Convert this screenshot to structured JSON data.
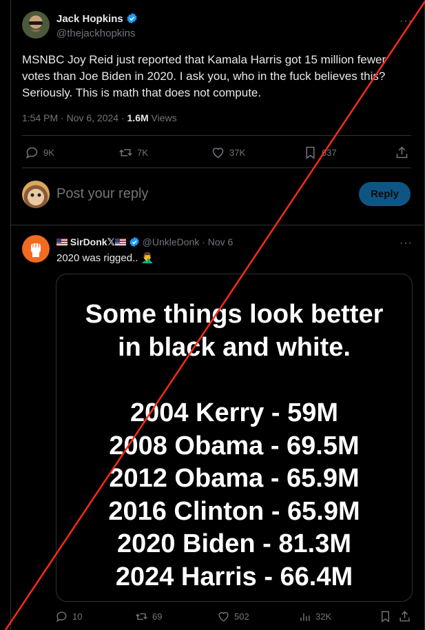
{
  "tweet": {
    "author_name": "Jack Hopkins",
    "author_handle": "@thejackhopkins",
    "text_lines": [
      "MSNBC Joy Reid just reported that Kamala Harris got 15 million fewer",
      "votes than Joe Biden in 2020. I ask you, who in the fuck believes this?",
      "Seriously. This is math that does not compute."
    ],
    "time": "1:54 PM · Nov 6, 2024 · ",
    "views_count": "1.6M",
    "views_label": " Views",
    "actions": {
      "replies": "9K",
      "reposts": "7K",
      "likes": "37K",
      "bookmarks": "637"
    }
  },
  "reply_box": {
    "placeholder": "Post your reply",
    "button": "Reply"
  },
  "reply": {
    "author_name": "SirDonk",
    "author_handle": "@UnkleDonk",
    "date": " · Nov 6",
    "text": "2020 was rigged.. 🤦‍♂️",
    "image_lines_top": [
      "Some things look better",
      "in black and white."
    ],
    "image_lines_bottom": [
      "2004 Kerry - 59M",
      "2008 Obama - 69.5M",
      "2012 Obama - 65.9M",
      "2016 Clinton - 65.9M",
      "2020 Biden - 81.3M",
      "2024 Harris - 66.4M"
    ],
    "actions": {
      "replies": "10",
      "reposts": "69",
      "likes": "502",
      "views": "32K"
    }
  },
  "colors": {
    "accent": "#1d9bf0",
    "overlay_line": "#ff2a1a",
    "background": "#000000"
  }
}
